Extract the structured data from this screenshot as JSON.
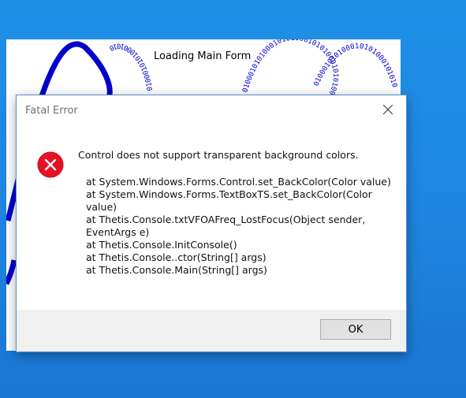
{
  "splash": {
    "title": "Loading Main Form",
    "binary_text": "0100010101000101010001010100010101000101010001010100"
  },
  "dialog": {
    "title": "Fatal Error",
    "icon": "error-icon",
    "message": "Control does not support transparent background colors.",
    "stack_trace": [
      "at System.Windows.Forms.Control.set_BackColor(Color value)",
      "at System.Windows.Forms.TextBoxTS.set_BackColor(Color value)",
      "at Thetis.Console.txtVFOAFreq_LostFocus(Object sender, EventArgs e)",
      "at Thetis.Console.InitConsole()",
      "at Thetis.Console..ctor(String[] args)",
      "at Thetis.Console.Main(String[] args)"
    ],
    "ok_label": "OK"
  },
  "colors": {
    "desktop": "#1e88e2",
    "wave": "#0000cc",
    "error_red": "#e81123",
    "footer": "#f0f0f0"
  }
}
